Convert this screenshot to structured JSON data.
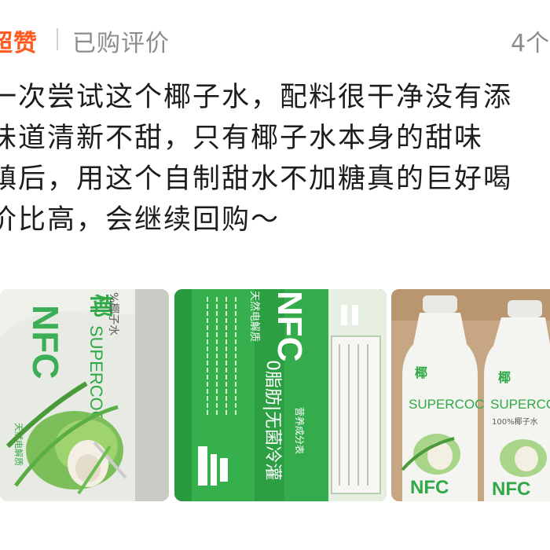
{
  "header": {
    "badge": "超赞",
    "purchased_label": "已购评价",
    "count": "4个"
  },
  "review": {
    "lines": [
      "一次尝试这个椰子水，配料很干净没有添",
      "   味道清新不甜，只有椰子水本身的甜味",
      "镇后，用这个自制甜水不加糖真的巨好喝",
      "价比高，会继续回购～"
    ]
  },
  "photos": [
    {
      "carton_brand": "椰",
      "carton_brand_en": "SUPERCOCO",
      "carton_sub": "%椰子水",
      "carton_side": "NFC",
      "carton_badge": "天然电解质"
    },
    {
      "big_text": "NFC",
      "side_text": "0脂肪|无菌冷灌",
      "top_text": "天然电解质",
      "nutrition_title": "营养成分表"
    },
    {
      "bottle_brand": "椰",
      "bottle_brand_en": "SUPERCOCO",
      "bottle_sub": "100%椰子水",
      "bottle_nfc": "NFC"
    }
  ],
  "colors": {
    "badge": "#ff5a1f",
    "muted": "#8c8c8c",
    "text": "#1d1d1d",
    "brand_green": "#2fa845"
  }
}
